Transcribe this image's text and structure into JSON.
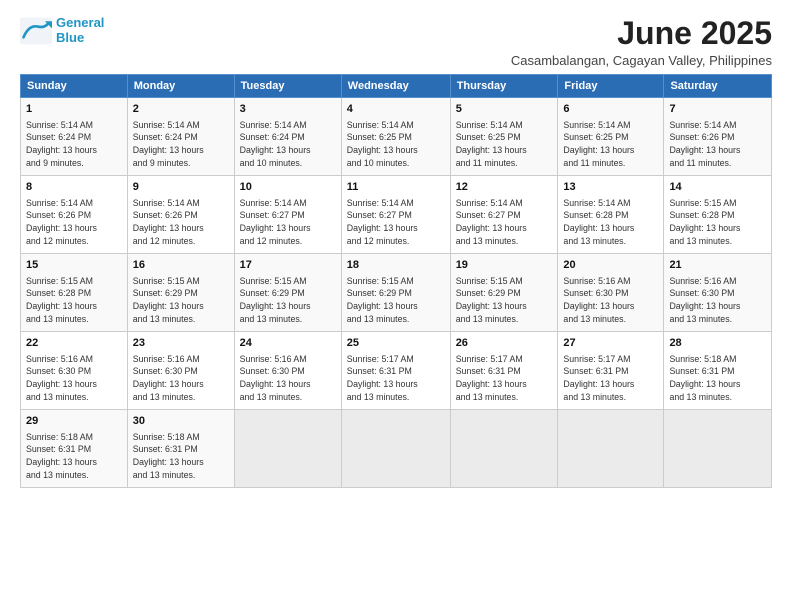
{
  "logo": {
    "line1": "General",
    "line2": "Blue"
  },
  "title": "June 2025",
  "location": "Casambalangan, Cagayan Valley, Philippines",
  "days_of_week": [
    "Sunday",
    "Monday",
    "Tuesday",
    "Wednesday",
    "Thursday",
    "Friday",
    "Saturday"
  ],
  "weeks": [
    [
      {
        "day": "1",
        "info": "Sunrise: 5:14 AM\nSunset: 6:24 PM\nDaylight: 13 hours\nand 9 minutes."
      },
      {
        "day": "2",
        "info": "Sunrise: 5:14 AM\nSunset: 6:24 PM\nDaylight: 13 hours\nand 9 minutes."
      },
      {
        "day": "3",
        "info": "Sunrise: 5:14 AM\nSunset: 6:24 PM\nDaylight: 13 hours\nand 10 minutes."
      },
      {
        "day": "4",
        "info": "Sunrise: 5:14 AM\nSunset: 6:25 PM\nDaylight: 13 hours\nand 10 minutes."
      },
      {
        "day": "5",
        "info": "Sunrise: 5:14 AM\nSunset: 6:25 PM\nDaylight: 13 hours\nand 11 minutes."
      },
      {
        "day": "6",
        "info": "Sunrise: 5:14 AM\nSunset: 6:25 PM\nDaylight: 13 hours\nand 11 minutes."
      },
      {
        "day": "7",
        "info": "Sunrise: 5:14 AM\nSunset: 6:26 PM\nDaylight: 13 hours\nand 11 minutes."
      }
    ],
    [
      {
        "day": "8",
        "info": "Sunrise: 5:14 AM\nSunset: 6:26 PM\nDaylight: 13 hours\nand 12 minutes."
      },
      {
        "day": "9",
        "info": "Sunrise: 5:14 AM\nSunset: 6:26 PM\nDaylight: 13 hours\nand 12 minutes."
      },
      {
        "day": "10",
        "info": "Sunrise: 5:14 AM\nSunset: 6:27 PM\nDaylight: 13 hours\nand 12 minutes."
      },
      {
        "day": "11",
        "info": "Sunrise: 5:14 AM\nSunset: 6:27 PM\nDaylight: 13 hours\nand 12 minutes."
      },
      {
        "day": "12",
        "info": "Sunrise: 5:14 AM\nSunset: 6:27 PM\nDaylight: 13 hours\nand 13 minutes."
      },
      {
        "day": "13",
        "info": "Sunrise: 5:14 AM\nSunset: 6:28 PM\nDaylight: 13 hours\nand 13 minutes."
      },
      {
        "day": "14",
        "info": "Sunrise: 5:15 AM\nSunset: 6:28 PM\nDaylight: 13 hours\nand 13 minutes."
      }
    ],
    [
      {
        "day": "15",
        "info": "Sunrise: 5:15 AM\nSunset: 6:28 PM\nDaylight: 13 hours\nand 13 minutes."
      },
      {
        "day": "16",
        "info": "Sunrise: 5:15 AM\nSunset: 6:29 PM\nDaylight: 13 hours\nand 13 minutes."
      },
      {
        "day": "17",
        "info": "Sunrise: 5:15 AM\nSunset: 6:29 PM\nDaylight: 13 hours\nand 13 minutes."
      },
      {
        "day": "18",
        "info": "Sunrise: 5:15 AM\nSunset: 6:29 PM\nDaylight: 13 hours\nand 13 minutes."
      },
      {
        "day": "19",
        "info": "Sunrise: 5:15 AM\nSunset: 6:29 PM\nDaylight: 13 hours\nand 13 minutes."
      },
      {
        "day": "20",
        "info": "Sunrise: 5:16 AM\nSunset: 6:30 PM\nDaylight: 13 hours\nand 13 minutes."
      },
      {
        "day": "21",
        "info": "Sunrise: 5:16 AM\nSunset: 6:30 PM\nDaylight: 13 hours\nand 13 minutes."
      }
    ],
    [
      {
        "day": "22",
        "info": "Sunrise: 5:16 AM\nSunset: 6:30 PM\nDaylight: 13 hours\nand 13 minutes."
      },
      {
        "day": "23",
        "info": "Sunrise: 5:16 AM\nSunset: 6:30 PM\nDaylight: 13 hours\nand 13 minutes."
      },
      {
        "day": "24",
        "info": "Sunrise: 5:16 AM\nSunset: 6:30 PM\nDaylight: 13 hours\nand 13 minutes."
      },
      {
        "day": "25",
        "info": "Sunrise: 5:17 AM\nSunset: 6:31 PM\nDaylight: 13 hours\nand 13 minutes."
      },
      {
        "day": "26",
        "info": "Sunrise: 5:17 AM\nSunset: 6:31 PM\nDaylight: 13 hours\nand 13 minutes."
      },
      {
        "day": "27",
        "info": "Sunrise: 5:17 AM\nSunset: 6:31 PM\nDaylight: 13 hours\nand 13 minutes."
      },
      {
        "day": "28",
        "info": "Sunrise: 5:18 AM\nSunset: 6:31 PM\nDaylight: 13 hours\nand 13 minutes."
      }
    ],
    [
      {
        "day": "29",
        "info": "Sunrise: 5:18 AM\nSunset: 6:31 PM\nDaylight: 13 hours\nand 13 minutes."
      },
      {
        "day": "30",
        "info": "Sunrise: 5:18 AM\nSunset: 6:31 PM\nDaylight: 13 hours\nand 13 minutes."
      },
      {
        "day": "",
        "info": ""
      },
      {
        "day": "",
        "info": ""
      },
      {
        "day": "",
        "info": ""
      },
      {
        "day": "",
        "info": ""
      },
      {
        "day": "",
        "info": ""
      }
    ]
  ]
}
